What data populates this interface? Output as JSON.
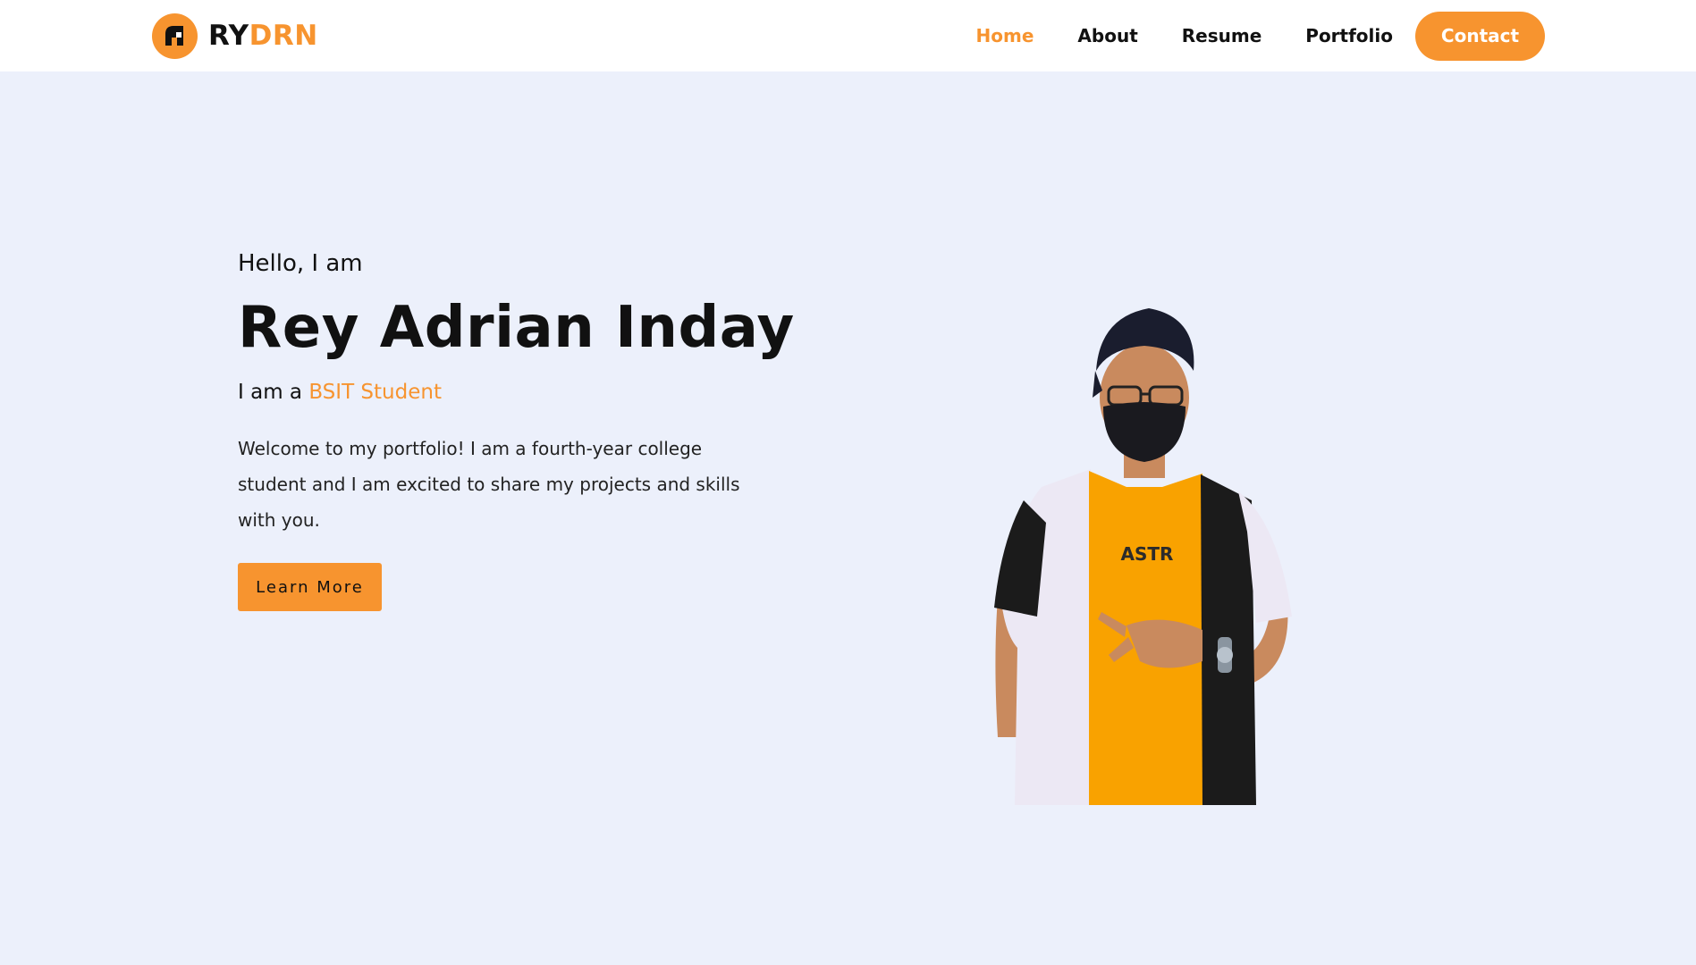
{
  "header": {
    "logo_part1": "RY",
    "logo_part2": "DRN",
    "nav": [
      "Home",
      "About",
      "Resume",
      "Portfolio"
    ],
    "contact_label": "Contact"
  },
  "hero": {
    "greeting": "Hello, I am",
    "name": "Rey Adrian Inday",
    "role_prefix": "I am a ",
    "role_highlight": "BSIT Student",
    "description": "Welcome to my portfolio! I am a fourth-year college student and I am excited to share my projects and skills with you.",
    "button_label": "Learn More",
    "shirt_text": "ASTR"
  },
  "colors": {
    "accent": "#f7942f",
    "background": "#ecf0fb",
    "header": "#ffffff"
  },
  "icons": [
    "logo-icon"
  ]
}
